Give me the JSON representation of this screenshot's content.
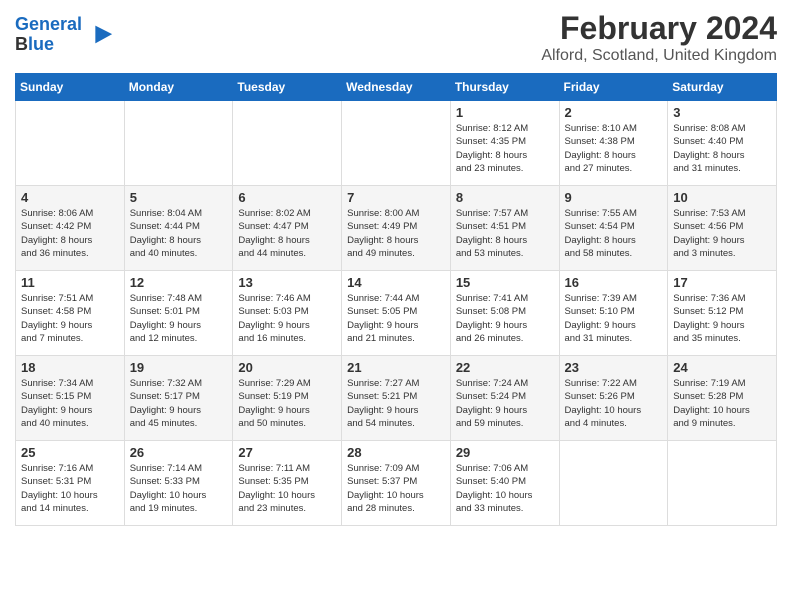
{
  "logo": {
    "line1": "General",
    "line2": "Blue"
  },
  "title": "February 2024",
  "subtitle": "Alford, Scotland, United Kingdom",
  "headers": [
    "Sunday",
    "Monday",
    "Tuesday",
    "Wednesday",
    "Thursday",
    "Friday",
    "Saturday"
  ],
  "weeks": [
    [
      {
        "day": "",
        "info": ""
      },
      {
        "day": "",
        "info": ""
      },
      {
        "day": "",
        "info": ""
      },
      {
        "day": "",
        "info": ""
      },
      {
        "day": "1",
        "info": "Sunrise: 8:12 AM\nSunset: 4:35 PM\nDaylight: 8 hours\nand 23 minutes."
      },
      {
        "day": "2",
        "info": "Sunrise: 8:10 AM\nSunset: 4:38 PM\nDaylight: 8 hours\nand 27 minutes."
      },
      {
        "day": "3",
        "info": "Sunrise: 8:08 AM\nSunset: 4:40 PM\nDaylight: 8 hours\nand 31 minutes."
      }
    ],
    [
      {
        "day": "4",
        "info": "Sunrise: 8:06 AM\nSunset: 4:42 PM\nDaylight: 8 hours\nand 36 minutes."
      },
      {
        "day": "5",
        "info": "Sunrise: 8:04 AM\nSunset: 4:44 PM\nDaylight: 8 hours\nand 40 minutes."
      },
      {
        "day": "6",
        "info": "Sunrise: 8:02 AM\nSunset: 4:47 PM\nDaylight: 8 hours\nand 44 minutes."
      },
      {
        "day": "7",
        "info": "Sunrise: 8:00 AM\nSunset: 4:49 PM\nDaylight: 8 hours\nand 49 minutes."
      },
      {
        "day": "8",
        "info": "Sunrise: 7:57 AM\nSunset: 4:51 PM\nDaylight: 8 hours\nand 53 minutes."
      },
      {
        "day": "9",
        "info": "Sunrise: 7:55 AM\nSunset: 4:54 PM\nDaylight: 8 hours\nand 58 minutes."
      },
      {
        "day": "10",
        "info": "Sunrise: 7:53 AM\nSunset: 4:56 PM\nDaylight: 9 hours\nand 3 minutes."
      }
    ],
    [
      {
        "day": "11",
        "info": "Sunrise: 7:51 AM\nSunset: 4:58 PM\nDaylight: 9 hours\nand 7 minutes."
      },
      {
        "day": "12",
        "info": "Sunrise: 7:48 AM\nSunset: 5:01 PM\nDaylight: 9 hours\nand 12 minutes."
      },
      {
        "day": "13",
        "info": "Sunrise: 7:46 AM\nSunset: 5:03 PM\nDaylight: 9 hours\nand 16 minutes."
      },
      {
        "day": "14",
        "info": "Sunrise: 7:44 AM\nSunset: 5:05 PM\nDaylight: 9 hours\nand 21 minutes."
      },
      {
        "day": "15",
        "info": "Sunrise: 7:41 AM\nSunset: 5:08 PM\nDaylight: 9 hours\nand 26 minutes."
      },
      {
        "day": "16",
        "info": "Sunrise: 7:39 AM\nSunset: 5:10 PM\nDaylight: 9 hours\nand 31 minutes."
      },
      {
        "day": "17",
        "info": "Sunrise: 7:36 AM\nSunset: 5:12 PM\nDaylight: 9 hours\nand 35 minutes."
      }
    ],
    [
      {
        "day": "18",
        "info": "Sunrise: 7:34 AM\nSunset: 5:15 PM\nDaylight: 9 hours\nand 40 minutes."
      },
      {
        "day": "19",
        "info": "Sunrise: 7:32 AM\nSunset: 5:17 PM\nDaylight: 9 hours\nand 45 minutes."
      },
      {
        "day": "20",
        "info": "Sunrise: 7:29 AM\nSunset: 5:19 PM\nDaylight: 9 hours\nand 50 minutes."
      },
      {
        "day": "21",
        "info": "Sunrise: 7:27 AM\nSunset: 5:21 PM\nDaylight: 9 hours\nand 54 minutes."
      },
      {
        "day": "22",
        "info": "Sunrise: 7:24 AM\nSunset: 5:24 PM\nDaylight: 9 hours\nand 59 minutes."
      },
      {
        "day": "23",
        "info": "Sunrise: 7:22 AM\nSunset: 5:26 PM\nDaylight: 10 hours\nand 4 minutes."
      },
      {
        "day": "24",
        "info": "Sunrise: 7:19 AM\nSunset: 5:28 PM\nDaylight: 10 hours\nand 9 minutes."
      }
    ],
    [
      {
        "day": "25",
        "info": "Sunrise: 7:16 AM\nSunset: 5:31 PM\nDaylight: 10 hours\nand 14 minutes."
      },
      {
        "day": "26",
        "info": "Sunrise: 7:14 AM\nSunset: 5:33 PM\nDaylight: 10 hours\nand 19 minutes."
      },
      {
        "day": "27",
        "info": "Sunrise: 7:11 AM\nSunset: 5:35 PM\nDaylight: 10 hours\nand 23 minutes."
      },
      {
        "day": "28",
        "info": "Sunrise: 7:09 AM\nSunset: 5:37 PM\nDaylight: 10 hours\nand 28 minutes."
      },
      {
        "day": "29",
        "info": "Sunrise: 7:06 AM\nSunset: 5:40 PM\nDaylight: 10 hours\nand 33 minutes."
      },
      {
        "day": "",
        "info": ""
      },
      {
        "day": "",
        "info": ""
      }
    ]
  ]
}
